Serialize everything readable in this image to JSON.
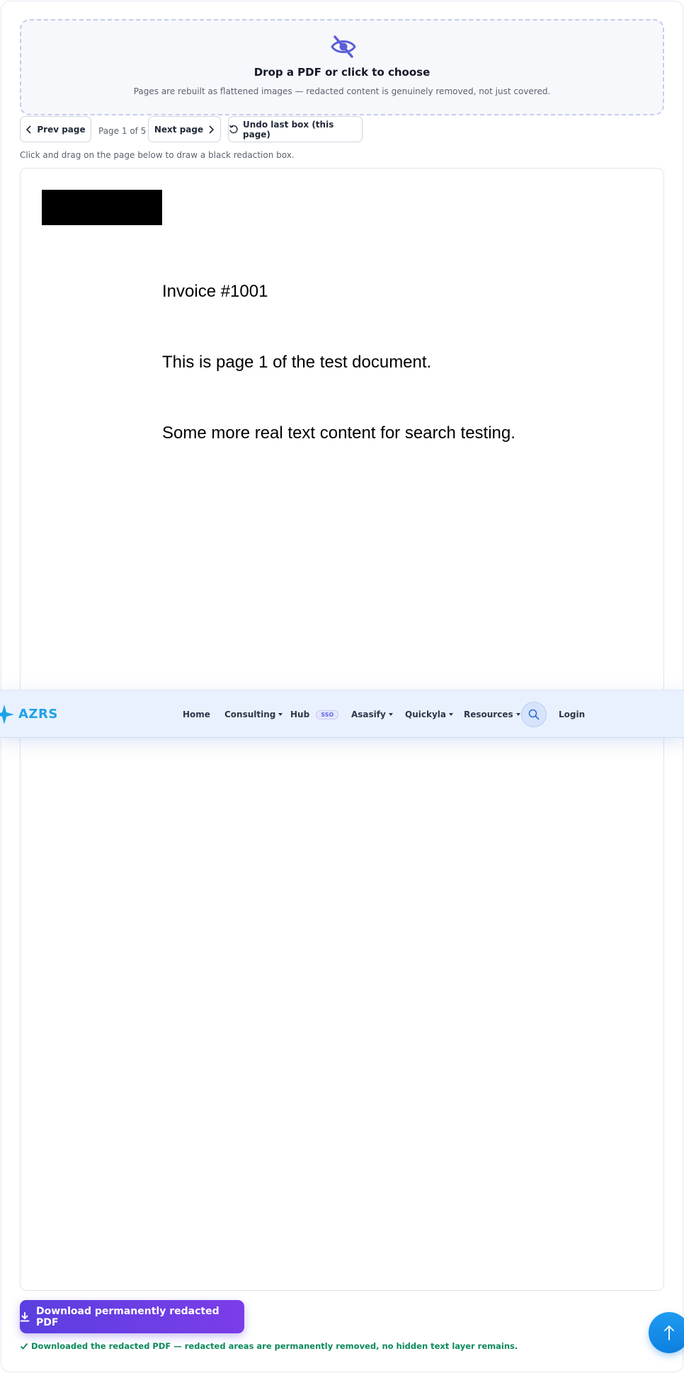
{
  "dropzone": {
    "icon": "eye-off-icon",
    "title": "Drop a PDF or click to choose",
    "subtitle": "Pages are rebuilt as flattened images — redacted content is genuinely removed, not just covered."
  },
  "controls": {
    "prev_label": "Prev page",
    "page_indicator": "Page 1 of 5",
    "next_label": "Next page",
    "undo_label": "Undo last box (this page)"
  },
  "hint": "Click and drag on the page below to draw a black redaction box.",
  "document": {
    "lines": [
      "Invoice #1001",
      "This is page 1 of the test document.",
      "Some more real text content for search testing."
    ]
  },
  "navbar": {
    "logo_text": "AZRS",
    "items": [
      {
        "label": "Home"
      },
      {
        "label": "Consulting"
      },
      {
        "label": "Hub",
        "badge": "SSO"
      },
      {
        "label": "Asasify"
      },
      {
        "label": "Quickyla"
      },
      {
        "label": "Resources"
      }
    ],
    "login_label": "Login"
  },
  "actions": {
    "download_label": "Download permanently redacted PDF",
    "success_message": "Downloaded the redacted PDF — redacted areas are permanently removed, no hidden text layer remains."
  },
  "colors": {
    "accent": "#6366f1",
    "download_gradient_start": "#5b3fe0",
    "download_gradient_end": "#7b3de8",
    "success": "#0b8a5a",
    "logo": "#1ea2e6"
  }
}
